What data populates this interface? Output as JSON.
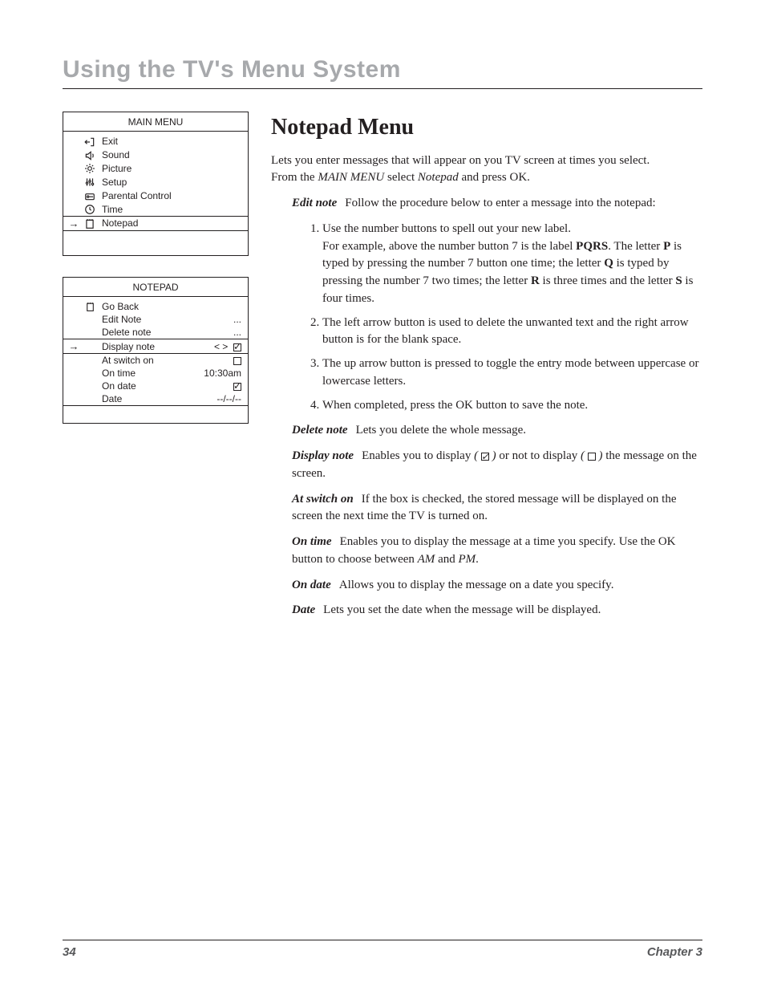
{
  "chapter_title": "Using the TV's Menu System",
  "main_menu": {
    "title": "MAIN MENU",
    "items": [
      {
        "label": "Exit"
      },
      {
        "label": "Sound"
      },
      {
        "label": "Picture"
      },
      {
        "label": "Setup"
      },
      {
        "label": "Parental Control"
      },
      {
        "label": "Time"
      },
      {
        "label": "Notepad",
        "selected": true
      }
    ]
  },
  "notepad_menu": {
    "title": "NOTEPAD",
    "items": [
      {
        "label": "Go Back",
        "value": ""
      },
      {
        "label": "Edit Note",
        "value": "..."
      },
      {
        "label": "Delete note",
        "value": "..."
      },
      {
        "label": "Display note",
        "value": "< > ☑",
        "selected": true
      },
      {
        "label": "At switch on",
        "value": "☐"
      },
      {
        "label": "On time",
        "value": "10:30am"
      },
      {
        "label": "On date",
        "value": "☑"
      },
      {
        "label": "Date",
        "value": "--/--/--"
      }
    ]
  },
  "content": {
    "heading": "Notepad Menu",
    "intro1": "Lets you enter messages that will appear on you TV screen at times you select.",
    "intro2_a": "From the ",
    "intro2_b": "MAIN MENU",
    "intro2_c": " select ",
    "intro2_d": "Notepad",
    "intro2_e": " and press OK.",
    "edit_note_term": "Edit note",
    "edit_note_text": "Follow the procedure below to enter a message into the notepad:",
    "step1a": "Use the number buttons to spell out your new label.",
    "step1b_a": "For example, above the number button 7 is the label ",
    "step1b_pqrs": "PQRS",
    "step1b_b": ". The letter ",
    "step1b_p": "P",
    "step1b_c": " is typed by pressing the number 7 button one time; the letter ",
    "step1b_q": "Q",
    "step1b_d": " is typed by pressing the number 7 two times; the letter ",
    "step1b_r": "R",
    "step1b_e": " is three times and the letter ",
    "step1b_s": "S",
    "step1b_f": " is four times.",
    "step2": "The left arrow button is used to delete the unwanted text and the right arrow button is for the blank space.",
    "step3": "The up arrow button is pressed to toggle the entry mode between uppercase or lowercase letters.",
    "step4": "When completed, press the OK button to save the note.",
    "delete_note_term": "Delete note",
    "delete_note_text": "Lets you delete the whole message.",
    "display_note_term": "Display note",
    "display_note_a": "Enables you to display ",
    "display_note_b": " or not to display ",
    "display_note_c": " the message on the screen.",
    "at_switch_term": "At switch on",
    "at_switch_text": "If the box is checked, the stored message will be displayed on the screen the next time the TV is turned on.",
    "on_time_term": "On time",
    "on_time_a": "Enables you to display the message at a time you specify. Use the OK button to choose between ",
    "on_time_am": "AM",
    "on_time_b": " and ",
    "on_time_pm": "PM",
    "on_time_c": ".",
    "on_date_term": "On date",
    "on_date_text": "Allows you to display the message on a date you specify.",
    "date_term": "Date",
    "date_text": "Lets you set the date when the message will be displayed."
  },
  "footer": {
    "page": "34",
    "chapter": "Chapter 3"
  }
}
